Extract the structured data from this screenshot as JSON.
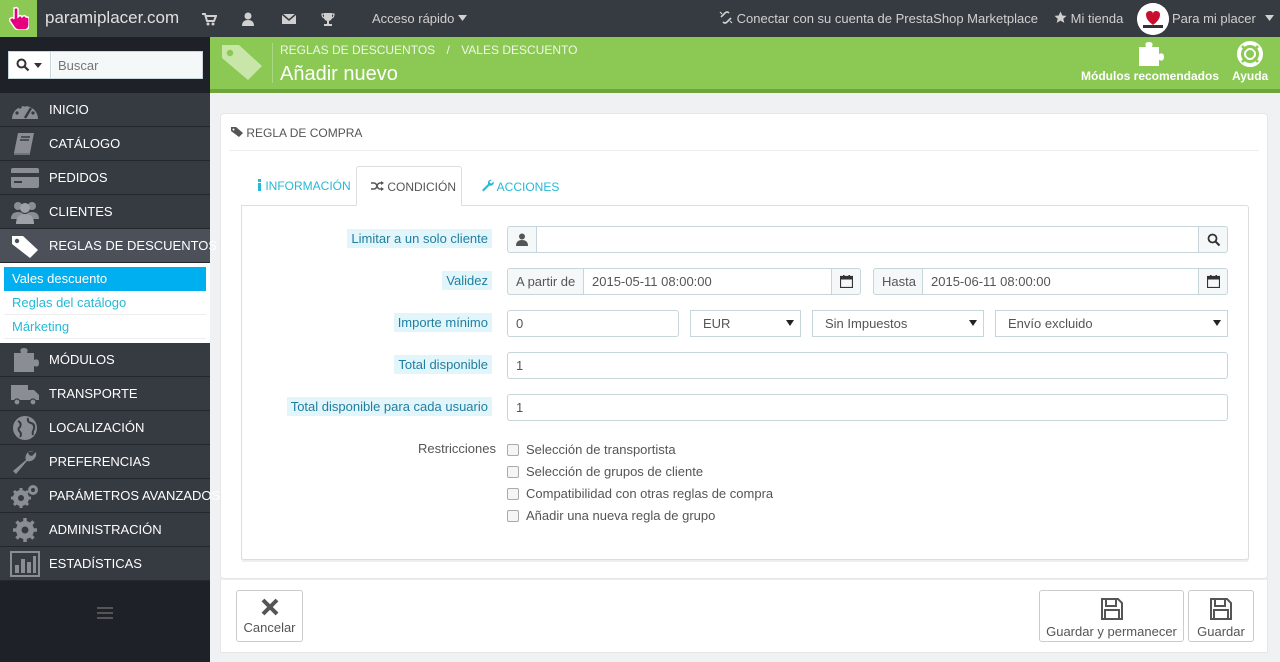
{
  "topbar": {
    "site_name": "paramiplacer.com",
    "quick_access": "Acceso rápido",
    "marketplace": "Conectar con su cuenta de PrestaShop Marketplace",
    "my_shop": "Mi tienda",
    "user_name": "Para mi placer"
  },
  "sidebar": {
    "search_placeholder": "Buscar",
    "items": [
      {
        "label": "Inicio"
      },
      {
        "label": "Catálogo"
      },
      {
        "label": "Pedidos"
      },
      {
        "label": "Clientes"
      },
      {
        "label": "Reglas de descuentos"
      },
      {
        "label": "Módulos"
      },
      {
        "label": "Transporte"
      },
      {
        "label": "Localización"
      },
      {
        "label": "Preferencias"
      },
      {
        "label": "Parámetros avanzados"
      },
      {
        "label": "Administración"
      },
      {
        "label": "Estadísticas"
      }
    ],
    "submenu": [
      {
        "label": "Vales descuento"
      },
      {
        "label": "Reglas del catálogo"
      },
      {
        "label": "Márketing"
      }
    ]
  },
  "header": {
    "breadcrumb_1": "Reglas de descuentos",
    "breadcrumb_sep": "/",
    "breadcrumb_2": "Vales descuento",
    "title": "Añadir nuevo",
    "tool_modules": "Módulos recomendados",
    "tool_help": "Ayuda"
  },
  "panel": {
    "heading": "Regla de compra",
    "tabs": [
      {
        "label": "Información"
      },
      {
        "label": "Condición"
      },
      {
        "label": "Acciones"
      }
    ],
    "form": {
      "customer_label": "Limitar a un solo cliente",
      "customer_value": "",
      "validity_label": "Validez",
      "from_label": "A partir de",
      "from_value": "2015-05-11 08:00:00",
      "to_label": "Hasta",
      "to_value": "2015-06-11 08:00:00",
      "min_amount_label": "Importe mínimo",
      "min_amount_value": "0",
      "currency": "EUR",
      "tax": "Sin Impuestos",
      "shipping": "Envío excluido",
      "total_label": "Total disponible",
      "total_value": "1",
      "per_user_label": "Total disponible para cada usuario",
      "per_user_value": "1",
      "restrictions_label": "Restricciones",
      "restrictions": [
        {
          "label": "Selección de transportista",
          "checked": false
        },
        {
          "label": "Selección de grupos de cliente",
          "checked": false
        },
        {
          "label": "Compatibilidad con otras reglas de compra",
          "checked": false
        },
        {
          "label": "Añadir una nueva regla de grupo",
          "checked": false
        }
      ]
    }
  },
  "footer": {
    "cancel": "Cancelar",
    "save_stay": "Guardar y permanecer",
    "save": "Guardar"
  },
  "colors": {
    "accent_green": "#8bc954",
    "link_blue": "#25b9d7",
    "active_blue": "#00aff0",
    "sidebar_dark": "#363a41"
  }
}
